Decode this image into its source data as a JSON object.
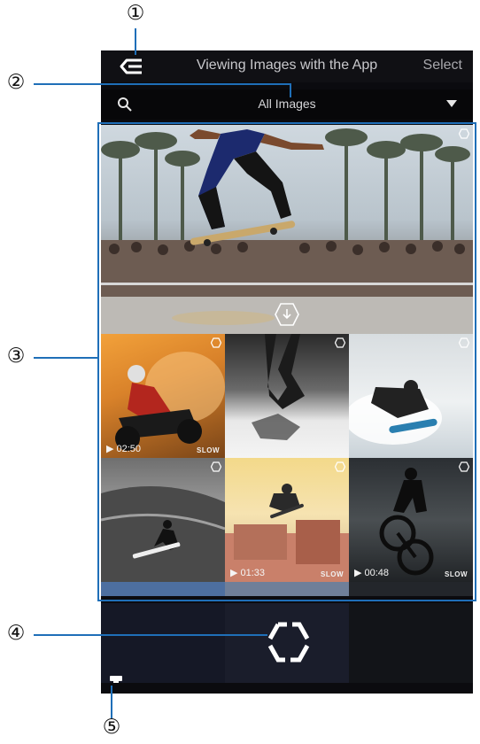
{
  "header": {
    "title": "Viewing Images with the App",
    "select_label": "Select"
  },
  "filter": {
    "label": "All Images"
  },
  "media": [
    {
      "type": "photo",
      "subject": "skateboarder-jump",
      "duration": "",
      "slow": ""
    },
    {
      "type": "video",
      "subject": "atv-rider-dust",
      "duration": "02:50",
      "slow": "SLOW"
    },
    {
      "type": "photo",
      "subject": "bmx-rider-shadow",
      "duration": "",
      "slow": ""
    },
    {
      "type": "photo",
      "subject": "snowboarder-powder",
      "duration": "",
      "slow": ""
    },
    {
      "type": "photo",
      "subject": "surfer-wave",
      "duration": "",
      "slow": ""
    },
    {
      "type": "video",
      "subject": "skate-ramp-air",
      "duration": "01:33",
      "slow": "SLOW"
    },
    {
      "type": "video",
      "subject": "bmx-wheelie",
      "duration": "00:48",
      "slow": "SLOW"
    }
  ],
  "callouts": [
    "①",
    "②",
    "③",
    "④",
    "⑤"
  ],
  "colors": {
    "callout_line": "#1f6fb8",
    "app_background": "#0b0b0f"
  }
}
